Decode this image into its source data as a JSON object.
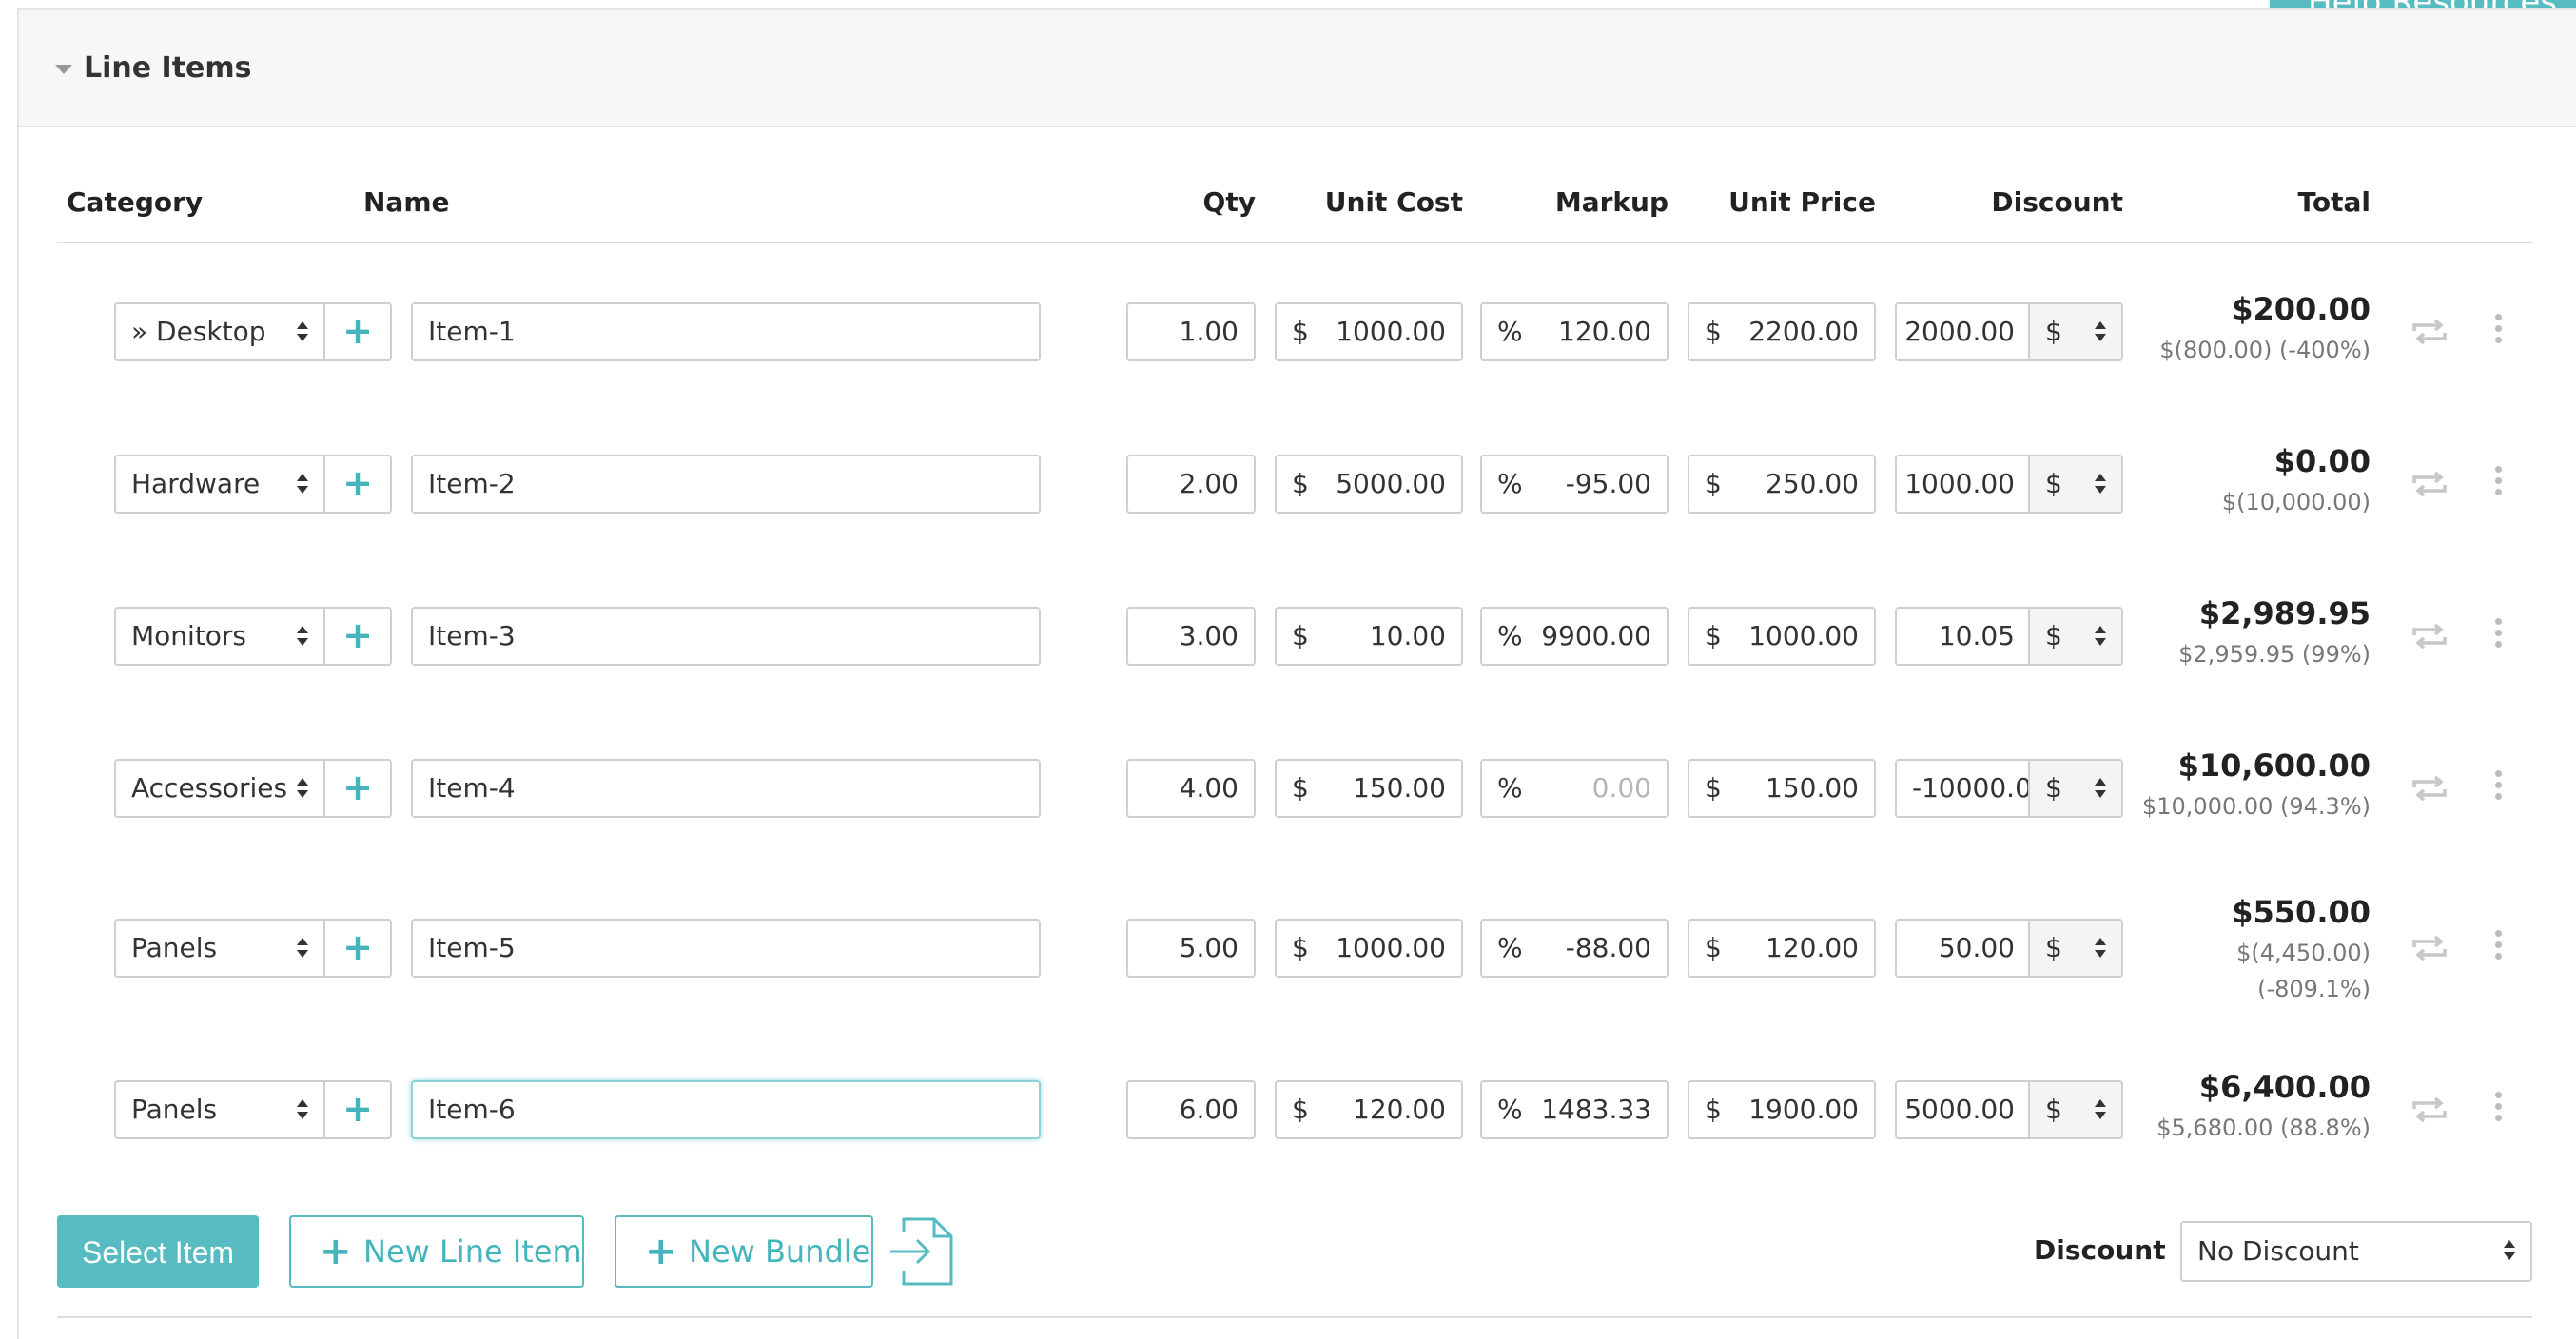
{
  "help_tab": {
    "label": "Help Resources"
  },
  "panel": {
    "title": "Line Items"
  },
  "columns": {
    "category": "Category",
    "name": "Name",
    "qty": "Qty",
    "unit_cost": "Unit Cost",
    "markup": "Markup",
    "unit_price": "Unit Price",
    "discount": "Discount",
    "total": "Total"
  },
  "symbols": {
    "currency": "$",
    "percent": "%",
    "add": "+"
  },
  "rows": [
    {
      "category": "» Desktop",
      "name": "Item-1",
      "qty": "1.00",
      "unit_cost": "1000.00",
      "markup": "120.00",
      "unit_price": "2200.00",
      "discount": "2000.00",
      "discount_type": "$",
      "total": "$200.00",
      "profit": "$(800.00) (-400%)",
      "profit2": ""
    },
    {
      "category": "Hardware",
      "name": "Item-2",
      "qty": "2.00",
      "unit_cost": "5000.00",
      "markup": "-95.00",
      "unit_price": "250.00",
      "discount": "1000.00",
      "discount_type": "$",
      "total": "$0.00",
      "profit": "$(10,000.00)",
      "profit2": ""
    },
    {
      "category": "Monitors",
      "name": "Item-3",
      "qty": "3.00",
      "unit_cost": "10.00",
      "markup": "9900.00",
      "unit_price": "1000.00",
      "discount": "10.05",
      "discount_type": "$",
      "total": "$2,989.95",
      "profit": "$2,959.95 (99%)",
      "profit2": ""
    },
    {
      "category": "Accessories",
      "name": "Item-4",
      "qty": "4.00",
      "unit_cost": "150.00",
      "markup": "0.00",
      "unit_price": "150.00",
      "discount": "-10000.0",
      "discount_type": "$",
      "total": "$10,600.00",
      "profit": "$10,000.00 (94.3%)",
      "profit2": ""
    },
    {
      "category": "Panels",
      "name": "Item-5",
      "qty": "5.00",
      "unit_cost": "1000.00",
      "markup": "-88.00",
      "unit_price": "120.00",
      "discount": "50.00",
      "discount_type": "$",
      "total": "$550.00",
      "profit": "$(4,450.00)",
      "profit2": "(-809.1%)"
    },
    {
      "category": "Panels",
      "name": "Item-6",
      "qty": "6.00",
      "unit_cost": "120.00",
      "markup": "1483.33",
      "unit_price": "1900.00",
      "discount": "5000.00",
      "discount_type": "$",
      "total": "$6,400.00",
      "profit": "$5,680.00 (88.8%)",
      "profit2": ""
    }
  ],
  "actions": {
    "select_item": "Select Item",
    "new_line_item": "New Line Item",
    "new_bundle": "New Bundle"
  },
  "discount": {
    "label": "Discount",
    "value": "No Discount"
  },
  "colors": {
    "accent": "#57bcc2",
    "border": "#cfcfcf",
    "muted": "#777777"
  },
  "icons": {
    "repeat": "repeat-icon",
    "more": "more-vertical-icon",
    "import": "file-import-icon",
    "caret": "caret-down-icon"
  }
}
